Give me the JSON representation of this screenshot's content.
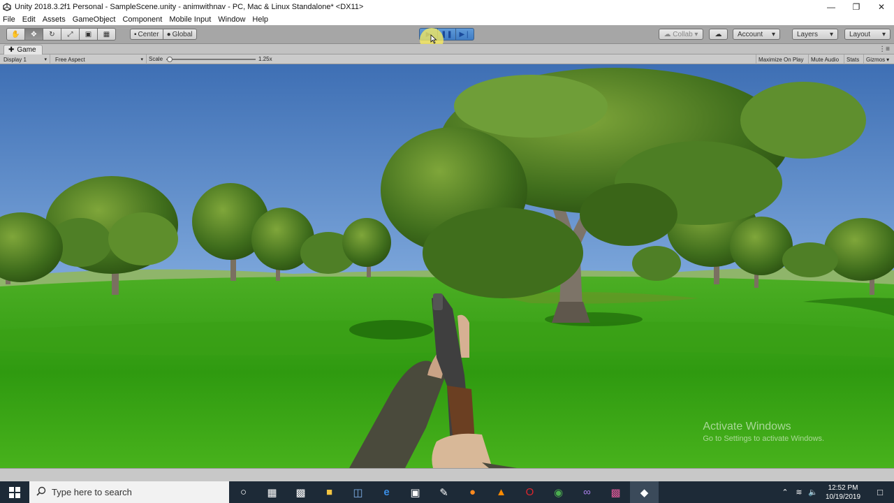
{
  "window": {
    "title": "Unity 2018.3.2f1 Personal - SampleScene.unity - animwithnav - PC, Mac & Linux Standalone* <DX11>",
    "controls": [
      "minimize",
      "maximize",
      "close"
    ]
  },
  "menu": [
    "File",
    "Edit",
    "Assets",
    "GameObject",
    "Component",
    "Mobile Input",
    "Window",
    "Help"
  ],
  "toolbar": {
    "tools": [
      "hand-tool",
      "move-tool",
      "rotate-tool",
      "scale-tool",
      "rect-tool",
      "transform-tool"
    ],
    "active_tool": "move-tool",
    "pivot_label": "Center",
    "space_label": "Global",
    "playback": [
      "play",
      "pause",
      "step"
    ],
    "collab_label": "Collab",
    "account_label": "Account",
    "layers_label": "Layers",
    "layout_label": "Layout"
  },
  "game_view": {
    "tab_label": "Game",
    "display_label": "Display 1",
    "aspect_label": "Free Aspect",
    "scale_label": "Scale",
    "scale_value": "1.25x",
    "maximize_label": "Maximize On Play",
    "mute_label": "Mute Audio",
    "stats_label": "Stats",
    "gizmos_label": "Gizmos"
  },
  "watermark": {
    "line1": "Activate Windows",
    "line2": "Go to Settings to activate Windows."
  },
  "taskbar": {
    "search_placeholder": "Type here to search",
    "apps": [
      "cortana",
      "task-view",
      "terminal",
      "file-explorer",
      "store-bag",
      "edge",
      "microsoft-store",
      "notepad",
      "firefox",
      "vlc",
      "opera",
      "chrome",
      "visual-studio",
      "media-app",
      "unity"
    ],
    "time": "12:52 PM",
    "date": "10/19/2019"
  },
  "colors": {
    "toolbar_bg": "#a6a6a6",
    "play_accent": "#4a86cc",
    "taskbar_bg": "#1d2a37",
    "sky": "#4f84c8",
    "grass": "#34a414"
  }
}
